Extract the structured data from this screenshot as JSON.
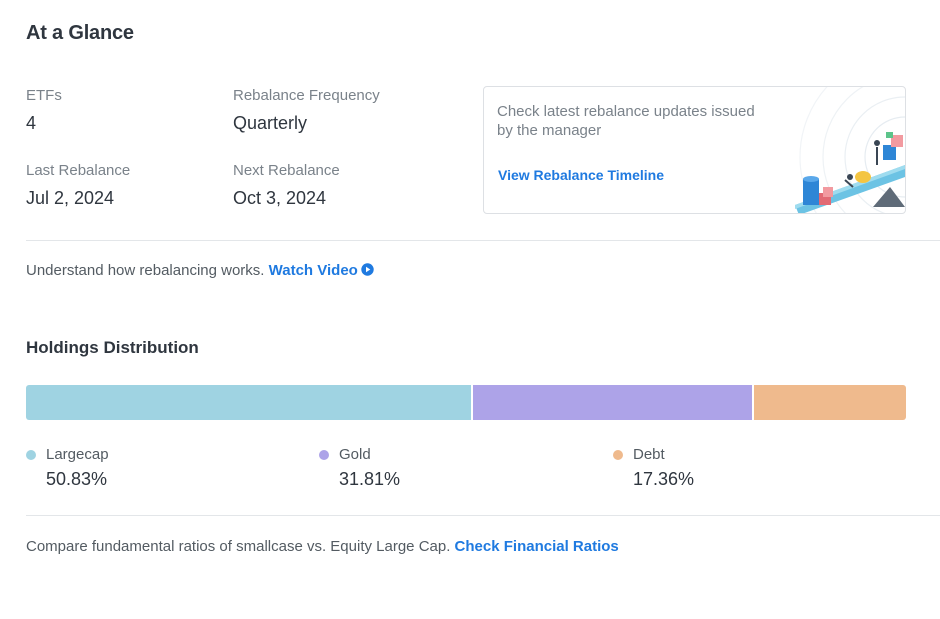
{
  "header": {
    "title": "At a Glance"
  },
  "stats": {
    "etfs": {
      "label": "ETFs",
      "value": "4"
    },
    "frequency": {
      "label": "Rebalance Frequency",
      "value": "Quarterly"
    },
    "last": {
      "label": "Last Rebalance",
      "value": "Jul 2, 2024"
    },
    "next": {
      "label": "Next Rebalance",
      "value": "Oct 3, 2024"
    }
  },
  "rebalance_card": {
    "text": "Check latest rebalance updates issued by the manager",
    "link": "View Rebalance Timeline",
    "illustration_icon": "rebalance-illustration-icon"
  },
  "video": {
    "text": "Understand how rebalancing works.",
    "link": "Watch Video",
    "icon": "play-icon"
  },
  "holdings": {
    "title": "Holdings Distribution",
    "items": [
      {
        "name": "Largecap",
        "percent": "50.83%",
        "share": 50.83,
        "color": "#9fd3e2"
      },
      {
        "name": "Gold",
        "percent": "31.81%",
        "share": 31.81,
        "color": "#ada3e8"
      },
      {
        "name": "Debt",
        "percent": "17.36%",
        "share": 17.36,
        "color": "#efba8d"
      }
    ]
  },
  "ratios": {
    "text": "Compare fundamental ratios of smallcase vs. Equity Large Cap.",
    "link": "Check Financial Ratios"
  },
  "colors": {
    "link": "#1f7ae0",
    "text": "#2f363f",
    "muted": "#7a828a"
  }
}
